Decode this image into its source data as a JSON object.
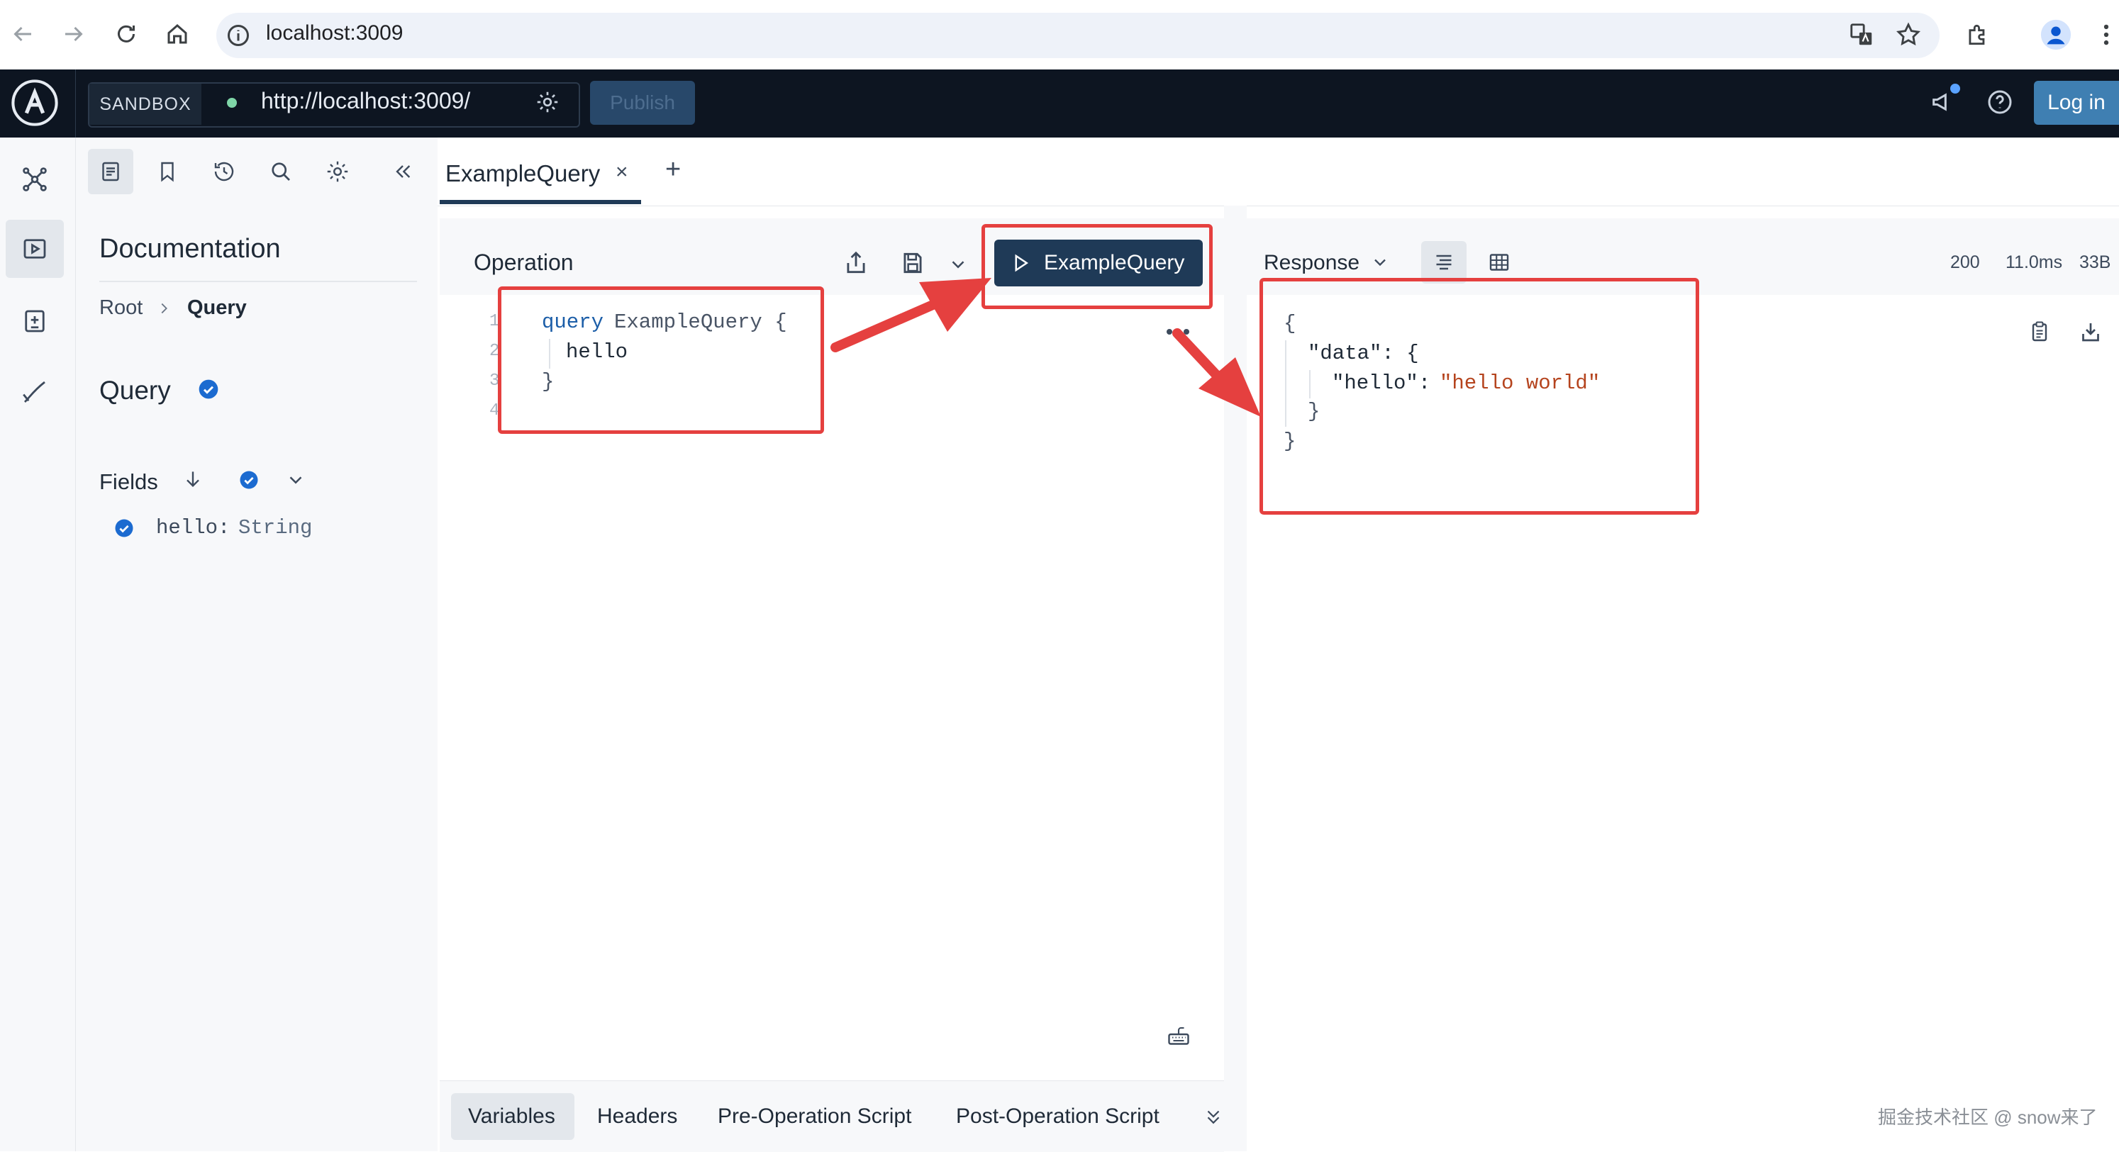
{
  "browser": {
    "url": "localhost:3009"
  },
  "header": {
    "sandbox_label": "SANDBOX",
    "endpoint": "http://localhost:3009/",
    "publish_label": "Publish",
    "login_label": "Log in"
  },
  "docs": {
    "title": "Documentation",
    "breadcrumb_root": "Root",
    "breadcrumb_current": "Query",
    "type_title": "Query",
    "fields_label": "Fields",
    "field_name": "hello:",
    "field_type": "String"
  },
  "tabs": {
    "active": "ExampleQuery",
    "close": "×",
    "add": "+"
  },
  "operation": {
    "title": "Operation",
    "run_label": "ExampleQuery",
    "code": {
      "line1_kw": "query",
      "line1_name": "ExampleQuery {",
      "line2": "hello",
      "line3": "}"
    },
    "line_numbers": [
      "1",
      "2",
      "3",
      "4"
    ]
  },
  "response": {
    "title": "Response",
    "status": "200",
    "time": "11.0ms",
    "size": "33B",
    "json": {
      "l1": "{",
      "l2_key": "\"data\": {",
      "l3_key": "\"hello\":",
      "l3_val": "\"hello world\"",
      "l4": "}",
      "l5": "}"
    }
  },
  "bottom_tabs": [
    "Variables",
    "Headers",
    "Pre-Operation Script",
    "Post-Operation Script"
  ],
  "watermark": "掘金技术社区 @ snow来了",
  "colors": {
    "header_bg": "#0d1521",
    "accent_blue": "#1c6bd0",
    "run_button": "#1f3a57",
    "annotation_red": "#e5403f",
    "string_red": "#b5441e"
  }
}
